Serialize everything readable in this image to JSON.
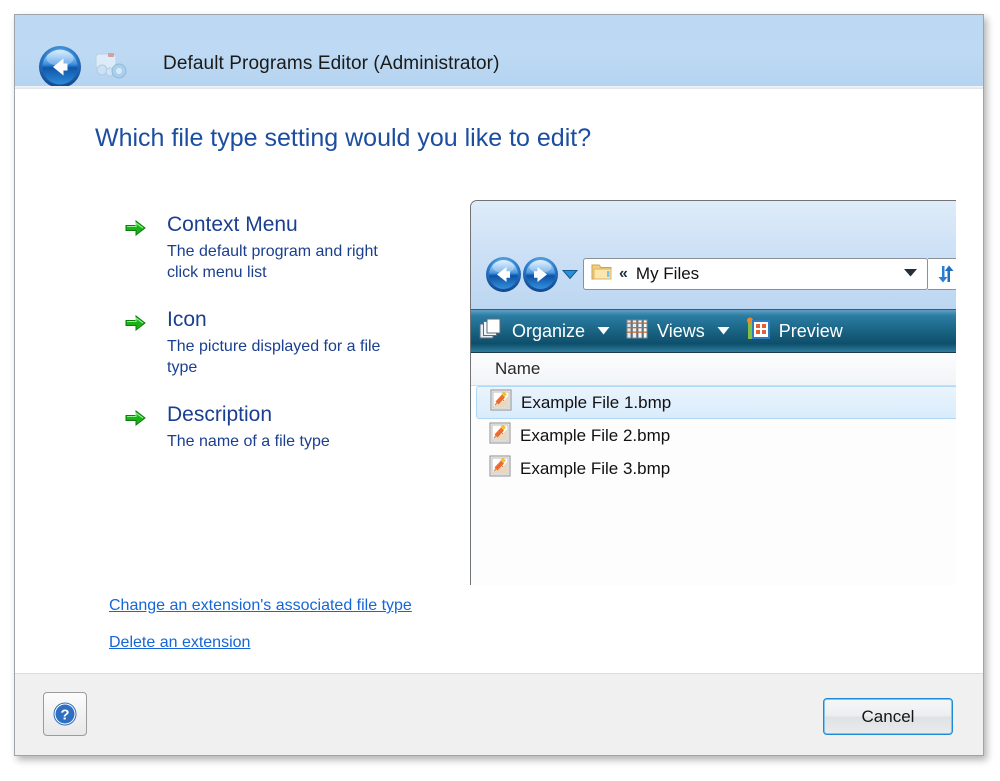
{
  "window": {
    "title": "Default Programs Editor (Administrator)",
    "back_icon": "back-arrow-icon",
    "app_icon": "default-programs-editor-icon"
  },
  "main": {
    "heading": "Which file type setting would you like to edit?",
    "tasks": [
      {
        "icon": "green-arrow-icon",
        "title": "Context Menu",
        "description": "The default program and right click menu list"
      },
      {
        "icon": "green-arrow-icon",
        "title": "Icon",
        "description": "The picture displayed for a file type"
      },
      {
        "icon": "green-arrow-icon",
        "title": "Description",
        "description": "The name of a file type"
      }
    ],
    "links": [
      "Change an extension's associated file type",
      "Delete an extension"
    ]
  },
  "explorer_preview": {
    "back_icon": "back-circle-icon",
    "forward_icon": "forward-circle-icon",
    "history_icon": "chevron-down-icon",
    "folder_icon": "folder-icon",
    "breadcrumb_separator": "«",
    "breadcrumb": "My Files",
    "address_dropdown_icon": "chevron-down-icon",
    "refresh_icon": "refresh-icon",
    "toolbar": [
      {
        "label": "Organize",
        "icon": "organize-icon",
        "has_caret": true
      },
      {
        "label": "Views",
        "icon": "views-icon",
        "has_caret": true
      },
      {
        "label": "Preview",
        "icon": "preview-icon",
        "has_caret": false
      }
    ],
    "column_header": "Name",
    "files": [
      {
        "name": "Example File 1.bmp",
        "icon": "bmp-file-icon",
        "selected": true
      },
      {
        "name": "Example File 2.bmp",
        "icon": "bmp-file-icon",
        "selected": false
      },
      {
        "name": "Example File 3.bmp",
        "icon": "bmp-file-icon",
        "selected": false
      }
    ]
  },
  "footer": {
    "help_icon": "help-question-icon",
    "cancel_label": "Cancel"
  },
  "colors": {
    "titlebar_blue": "#bcd8f2",
    "heading_blue": "#1b4ea0",
    "task_blue": "#1b3f8f",
    "link_blue": "#1566d6",
    "toolbar_dark": "#17607f",
    "arrow_green": "#21b521",
    "focus_blue": "#1d8bd6"
  }
}
